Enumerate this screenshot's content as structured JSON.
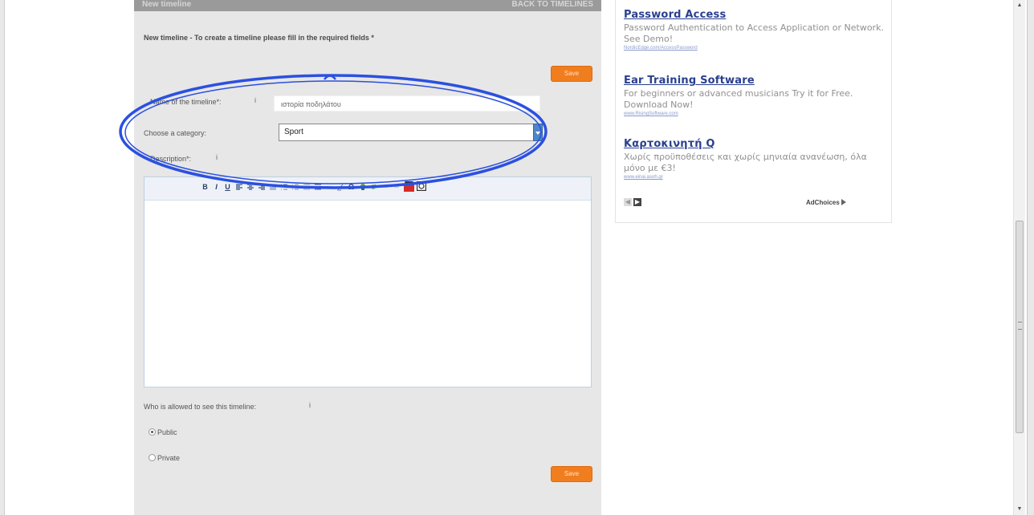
{
  "form": {
    "header_left": "New timeline",
    "header_right": "BACK TO TIMELINES",
    "intro": "New timeline - To create a timeline please fill in the required fields *",
    "save_label": "Save",
    "name_label": "Name of the timeline*:",
    "name_value": "ιστορία ποδηλάτου",
    "info_mark": "i",
    "category_label": "Choose a category:",
    "category_value": "Sport",
    "description_label": "Description*:",
    "visibility_label": "Who is allowed to see this timeline:",
    "public_label": "Public",
    "private_label": "Private"
  },
  "editor_toolbar": {
    "bold": "B",
    "italic": "I",
    "underline": "U",
    "omega": "Ω"
  },
  "ads": [
    {
      "title": "Password Access",
      "body": "Password Authentication to Access Application or Network. See Demo!",
      "url": "NordicEdge.com/AccessPassword"
    },
    {
      "title": "Ear Training Software",
      "body": "For beginners or advanced musicians Try it for Free. Download Now!",
      "url": "www.RisingSoftware.com"
    },
    {
      "title": "Καρτοκινητή Q",
      "body": "Χωρίς προϋποθέσεις και χωρίς μηνιαία ανανέωση, όλα μόνο με €3!",
      "url": "www.einai.asoh.gr"
    }
  ],
  "ad_nav": {
    "prev": "◀",
    "next": "▶"
  },
  "adchoices": "AdChoices",
  "scrollbar": {
    "up": "▲",
    "down": "▼"
  },
  "colors": {
    "save_button": "#f07d1e",
    "annotation_ellipse": "#2b50e0",
    "ad_title": "#2a3f8f",
    "select_arrow": "#4f86c6"
  }
}
